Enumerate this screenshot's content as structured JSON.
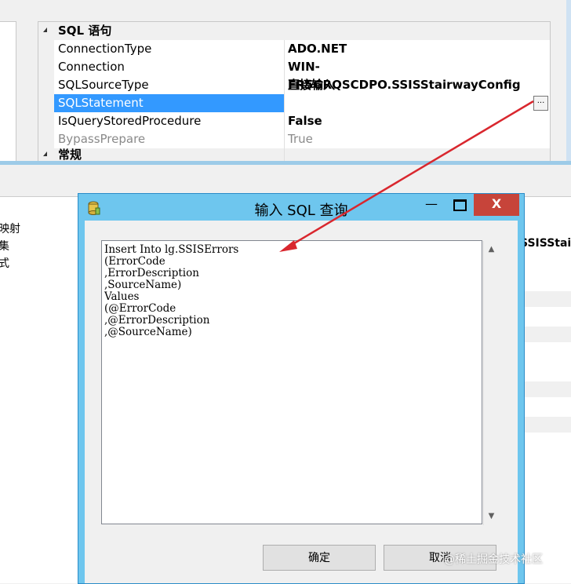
{
  "property_grid": {
    "section_sql": "SQL 语句",
    "rows": [
      {
        "name": "ConnectionType",
        "value": "ADO.NET"
      },
      {
        "name": "Connection",
        "value": "WIN-FR5GRQSCDPO.SSISStairwayConfig"
      },
      {
        "name": "SQLSourceType",
        "value": "直接输入"
      },
      {
        "name": "SQLStatement",
        "value": ""
      },
      {
        "name": "IsQueryStoredProcedure",
        "value": "False"
      },
      {
        "name": "BypassPrepare",
        "value": "True"
      }
    ],
    "section_general": "常规",
    "ellipsis": "..."
  },
  "background": {
    "left_fragments": [
      "映射",
      "集",
      "式"
    ],
    "right_fragment": "SSISStair"
  },
  "dialog": {
    "title": "输入 SQL 查询",
    "min_glyph": "—",
    "max_glyph": "☐",
    "close_glyph": "X",
    "sql_text": "Insert Into lg.SSISErrors\n(ErrorCode\n,ErrorDescription\n,SourceName)\nValues\n(@ErrorCode\n,@ErrorDescription\n,@SourceName)",
    "ok_label": "确定",
    "cancel_label": "取消"
  },
  "watermark": "@稀土掘金技术社区",
  "colors": {
    "selection": "#3399ff",
    "dialog_frame": "#6ec6ee",
    "close_button": "#c7443a",
    "annotation_arrow": "#d9272e"
  }
}
